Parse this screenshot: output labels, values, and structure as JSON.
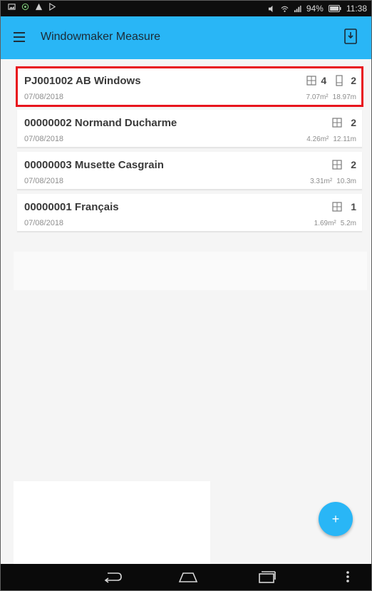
{
  "status_bar": {
    "battery": "94%",
    "time": "11:38"
  },
  "app_bar": {
    "title": "Windowmaker Measure"
  },
  "jobs": [
    {
      "title": "PJ001002 AB Windows",
      "date": "07/08/2018",
      "windows": "4",
      "doors": "2",
      "area": "7.07m²",
      "length": "18.97m"
    },
    {
      "title": "00000002 Normand Ducharme",
      "date": "07/08/2018",
      "windows": "2",
      "area": "4.26m²",
      "length": "12.11m"
    },
    {
      "title": "00000003 Musette Casgrain",
      "date": "07/08/2018",
      "windows": "2",
      "area": "3.31m²",
      "length": "10.3m"
    },
    {
      "title": "00000001 Français",
      "date": "07/08/2018",
      "windows": "1",
      "area": "1.69m²",
      "length": "5.2m"
    }
  ],
  "fab": {
    "label": "+"
  },
  "colors": {
    "accent": "#29b6f6",
    "selection": "#e8141d",
    "status_bar": "#0e0e0e"
  },
  "icons": {
    "window": "window-icon",
    "door": "door-icon",
    "menu": "hamburger-icon",
    "save": "save-to-device-icon"
  }
}
